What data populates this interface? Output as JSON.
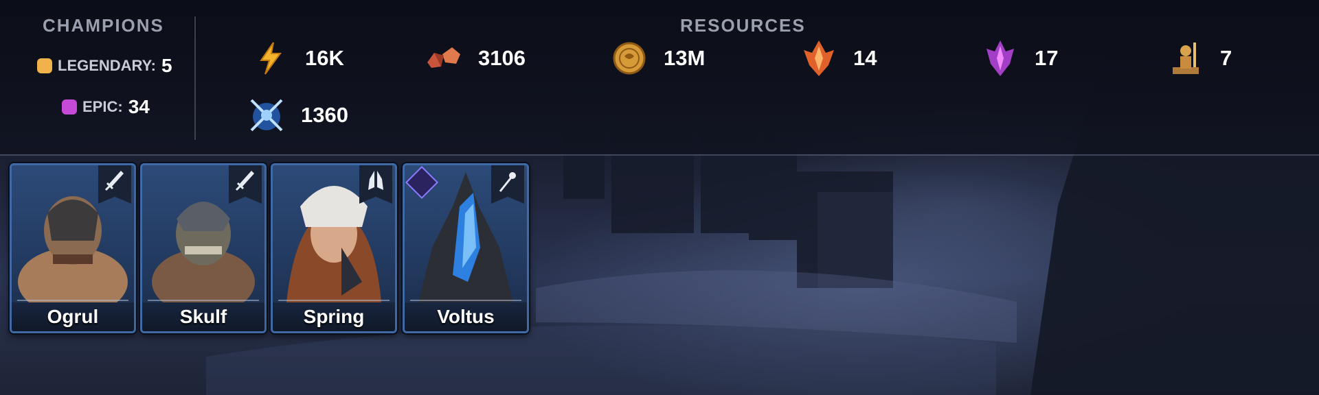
{
  "champions": {
    "title": "CHAMPIONS",
    "legendary": {
      "label": "LEGENDARY:",
      "count": "5",
      "color": "#f0b24a"
    },
    "epic": {
      "label": "EPIC:",
      "count": "34",
      "color": "#c64ad8"
    }
  },
  "resources": {
    "title": "RESOURCES",
    "items": [
      {
        "icon": "energy-icon",
        "value": "16K"
      },
      {
        "icon": "rubies-icon",
        "value": "3106"
      },
      {
        "icon": "silver-coin-icon",
        "value": "13M"
      },
      {
        "icon": "fire-shard-icon",
        "value": "14"
      },
      {
        "icon": "void-shard-icon",
        "value": "17"
      },
      {
        "icon": "sacred-knight-icon",
        "value": "7"
      },
      {
        "icon": "arena-token-icon",
        "value": "1360"
      }
    ]
  },
  "cards": [
    {
      "name": "Ogrul",
      "role_icon": "sword-icon",
      "border": "#3f6aa6"
    },
    {
      "name": "Skulf",
      "role_icon": "sword-icon",
      "border": "#3f6aa6"
    },
    {
      "name": "Spring",
      "role_icon": "praying-hands-icon",
      "border": "#3f6aa6"
    },
    {
      "name": "Voltus",
      "role_icon": "staff-icon",
      "affinity_icon": "void-affinity-icon",
      "border": "#3f6aa6"
    }
  ]
}
